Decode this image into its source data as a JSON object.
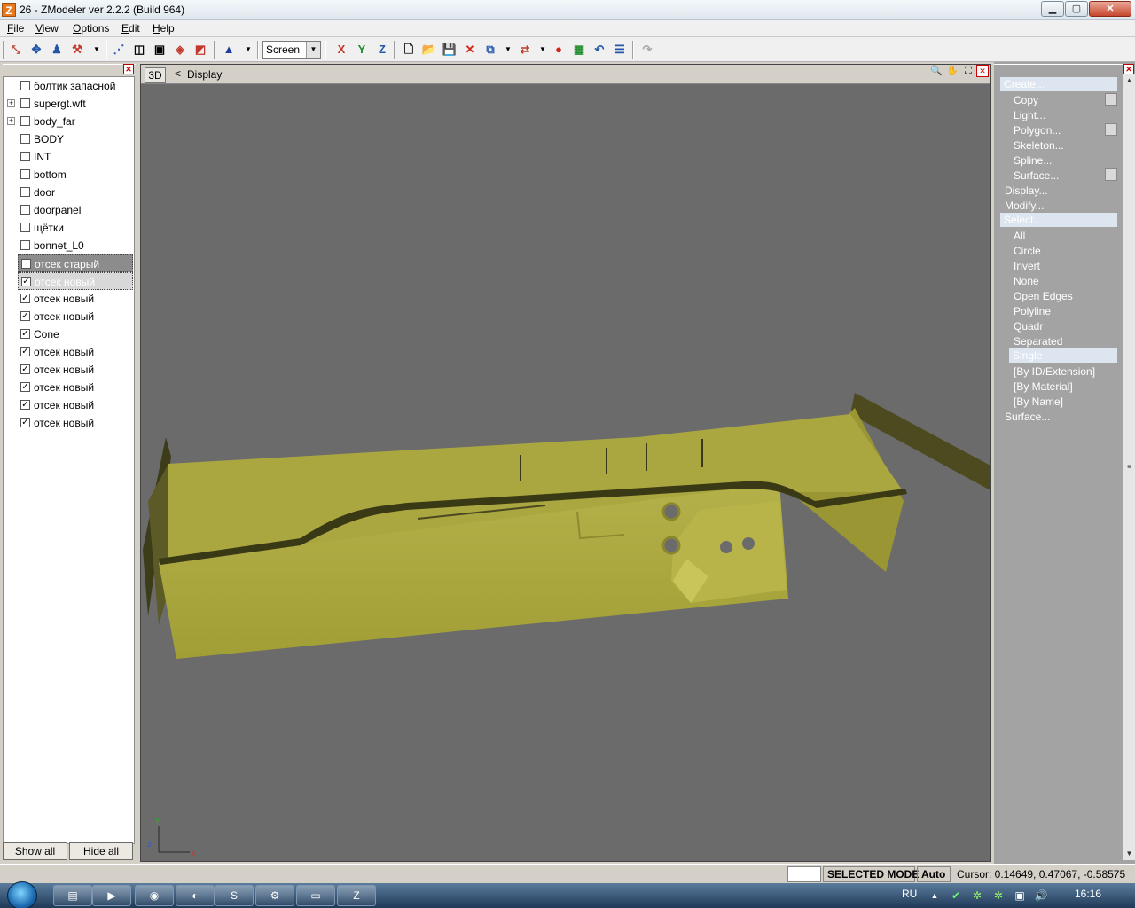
{
  "window": {
    "title": "26 - ZModeler ver 2.2.2 (Build 964)",
    "icon_letter": "Z",
    "minimize_glyph": "▁",
    "maximize_glyph": "▢",
    "close_glyph": "✕"
  },
  "menu": {
    "items": [
      {
        "first": "F",
        "rest": "ile"
      },
      {
        "first": "V",
        "rest": "iew"
      },
      {
        "first": "O",
        "rest": "ptions"
      },
      {
        "first": "E",
        "rest": "dit"
      },
      {
        "first": "H",
        "rest": "elp"
      }
    ]
  },
  "toolbar": {
    "space_selector": "Screen",
    "axis_x": "X",
    "axis_y": "Y",
    "axis_z": "Z"
  },
  "left_panel": {
    "close_glyph": "✕",
    "check_mark": "✓",
    "expand_glyph": "+",
    "objects": [
      {
        "label": "болтик запасной",
        "checked": false,
        "expandable": false,
        "state": "normal"
      },
      {
        "label": "supergt.wft",
        "checked": false,
        "expandable": true,
        "state": "normal"
      },
      {
        "label": "body_far",
        "checked": false,
        "expandable": true,
        "state": "normal"
      },
      {
        "label": "BODY",
        "checked": false,
        "expandable": false,
        "state": "normal"
      },
      {
        "label": "INT",
        "checked": false,
        "expandable": false,
        "state": "normal"
      },
      {
        "label": "bottom",
        "checked": false,
        "expandable": false,
        "state": "normal"
      },
      {
        "label": "door",
        "checked": false,
        "expandable": false,
        "state": "normal"
      },
      {
        "label": "doorpanel",
        "checked": false,
        "expandable": false,
        "state": "normal"
      },
      {
        "label": "щётки",
        "checked": false,
        "expandable": false,
        "state": "normal"
      },
      {
        "label": "bonnet_L0",
        "checked": false,
        "expandable": false,
        "state": "normal"
      },
      {
        "label": "отсек старый",
        "checked": false,
        "expandable": false,
        "state": "selected"
      },
      {
        "label": "отсек новый",
        "checked": true,
        "expandable": false,
        "state": "focused"
      },
      {
        "label": "отсек новый",
        "checked": true,
        "expandable": false,
        "state": "normal"
      },
      {
        "label": "отсек новый",
        "checked": true,
        "expandable": false,
        "state": "normal"
      },
      {
        "label": "Cone",
        "checked": true,
        "expandable": false,
        "state": "normal"
      },
      {
        "label": "отсек новый",
        "checked": true,
        "expandable": false,
        "state": "normal"
      },
      {
        "label": "отсек новый",
        "checked": true,
        "expandable": false,
        "state": "normal"
      },
      {
        "label": "отсек новый",
        "checked": true,
        "expandable": false,
        "state": "normal"
      },
      {
        "label": "отсек новый",
        "checked": true,
        "expandable": false,
        "state": "normal"
      },
      {
        "label": "отсек новый",
        "checked": true,
        "expandable": false,
        "state": "normal"
      }
    ],
    "show_all": "Show all",
    "hide_all": "Hide all"
  },
  "viewport": {
    "mode_label": "3D",
    "collapse_glyph": "<",
    "title": "Display",
    "axis_y": "y",
    "axis_z": "z",
    "axis_x": "x",
    "model_color": "#a9a53c"
  },
  "right_panel": {
    "close_glyph": "✕",
    "create": "Create...",
    "create_items": [
      "Copy",
      "Light...",
      "Polygon...",
      "Skeleton...",
      "Spline...",
      "Surface..."
    ],
    "display": "Display...",
    "modify": "Modify...",
    "select": "Select...",
    "select_items": [
      "All",
      "Circle",
      "Invert",
      "None",
      "Open Edges",
      "Polyline",
      "Quadr",
      "Separated",
      "Single",
      "[By ID/Extension]",
      "[By Material]",
      "[By Name]"
    ],
    "surface": "Surface...",
    "highlight_color": "#dde6f0"
  },
  "statusbar": {
    "mode": "SELECTED MODE",
    "auto": "Auto",
    "cursor": "Cursor: 0.14649, 0.47067, -0.58575"
  },
  "taskbar": {
    "lang": "RU",
    "time": "16:16"
  }
}
